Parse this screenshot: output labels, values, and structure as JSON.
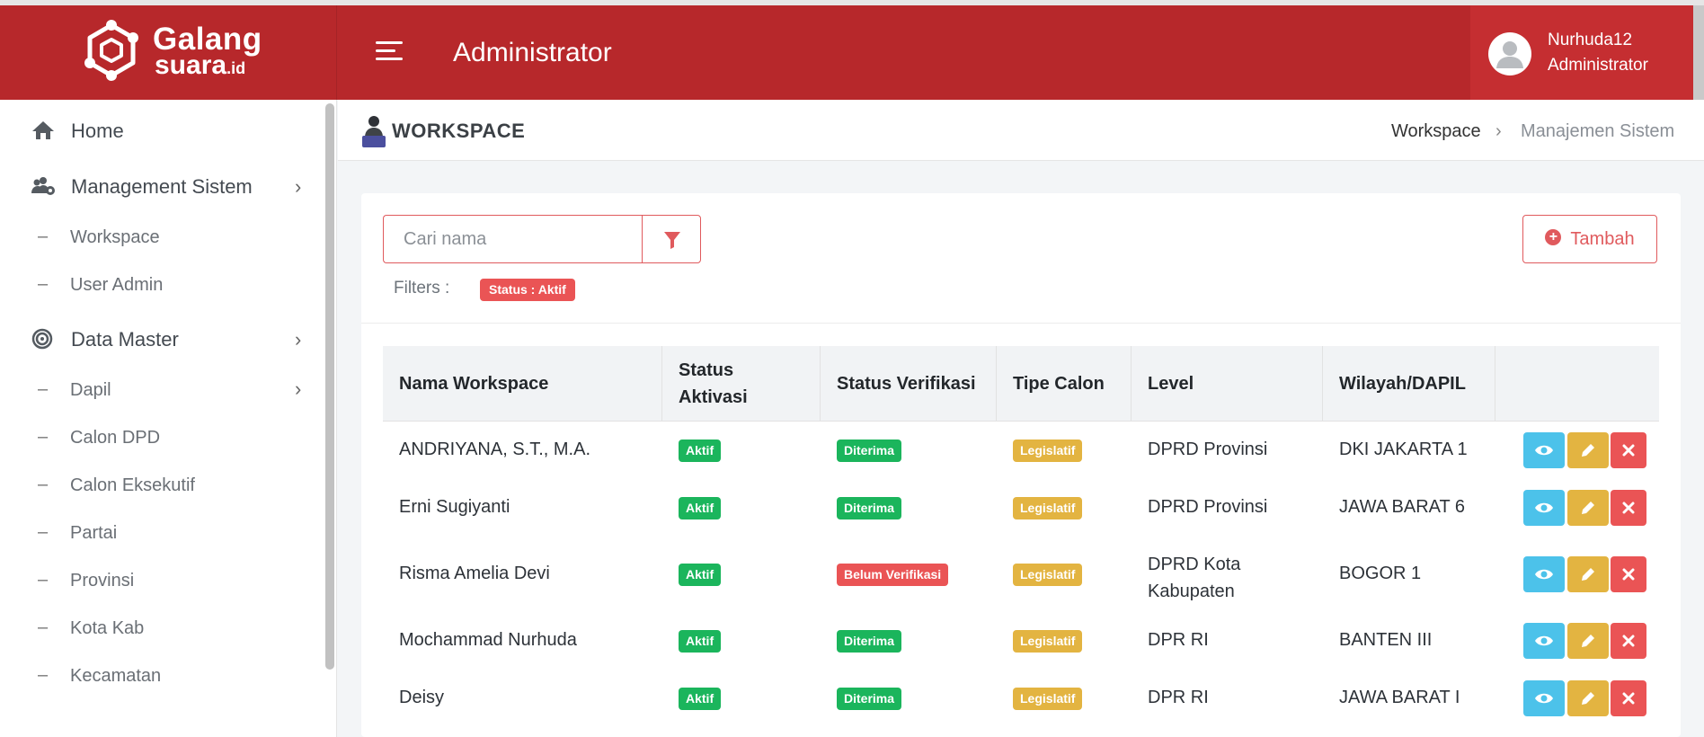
{
  "brand": {
    "line1": "Galang",
    "line2": "suara",
    "suffix": ".id"
  },
  "header": {
    "title": "Administrator"
  },
  "user": {
    "name": "Nurhuda12",
    "role": "Administrator"
  },
  "colors": {
    "primary": "#b7282b",
    "accent": "#e05a5d",
    "success": "#1bb55c",
    "warning": "#e3b441",
    "info": "#4cc2ea",
    "danger": "#ea5455"
  },
  "sidebar": {
    "home": {
      "label": "Home",
      "icon": "home-icon"
    },
    "management": {
      "label": "Management Sistem",
      "icon": "users-cog-icon"
    },
    "management_items": [
      {
        "label": "Workspace"
      },
      {
        "label": "User Admin"
      }
    ],
    "data_master": {
      "label": "Data Master",
      "icon": "target-icon"
    },
    "data_master_items": [
      {
        "label": "Dapil"
      },
      {
        "label": "Calon DPD"
      },
      {
        "label": "Calon Eksekutif"
      },
      {
        "label": "Partai"
      },
      {
        "label": "Provinsi"
      },
      {
        "label": "Kota Kab"
      },
      {
        "label": "Kecamatan"
      }
    ]
  },
  "page": {
    "title": "WORKSPACE"
  },
  "breadcrumb": {
    "item1": "Workspace",
    "item2": "Manajemen Sistem"
  },
  "search": {
    "placeholder": "Cari nama"
  },
  "filters": {
    "label": "Filters :",
    "chip": "Status : Aktif"
  },
  "add_button": {
    "label": "Tambah"
  },
  "table": {
    "headers": [
      {
        "label": "Nama Workspace"
      },
      {
        "label": "Status Aktivasi"
      },
      {
        "label": "Status Verifikasi"
      },
      {
        "label": "Tipe Calon"
      },
      {
        "label": "Level"
      },
      {
        "label": "Wilayah/DAPIL"
      }
    ],
    "rows": [
      {
        "name": "ANDRIYANA, S.T., M.A.",
        "aktivasi": "Aktif",
        "verifikasi": "Diterima",
        "tipe": "Legislatif",
        "level": "DPRD Provinsi",
        "wilayah": "DKI JAKARTA 1"
      },
      {
        "name": "Erni Sugiyanti",
        "aktivasi": "Aktif",
        "verifikasi": "Diterima",
        "tipe": "Legislatif",
        "level": "DPRD Provinsi",
        "wilayah": "JAWA BARAT 6"
      },
      {
        "name": "Risma Amelia Devi",
        "aktivasi": "Aktif",
        "verifikasi": "Belum Verifikasi",
        "tipe": "Legislatif",
        "level": "DPRD Kota Kabupaten",
        "wilayah": "BOGOR 1"
      },
      {
        "name": "Mochammad Nurhuda",
        "aktivasi": "Aktif",
        "verifikasi": "Diterima",
        "tipe": "Legislatif",
        "level": "DPR RI",
        "wilayah": "BANTEN III"
      },
      {
        "name": "Deisy",
        "aktivasi": "Aktif",
        "verifikasi": "Diterima",
        "tipe": "Legislatif",
        "level": "DPR RI",
        "wilayah": "JAWA BARAT I"
      }
    ]
  }
}
